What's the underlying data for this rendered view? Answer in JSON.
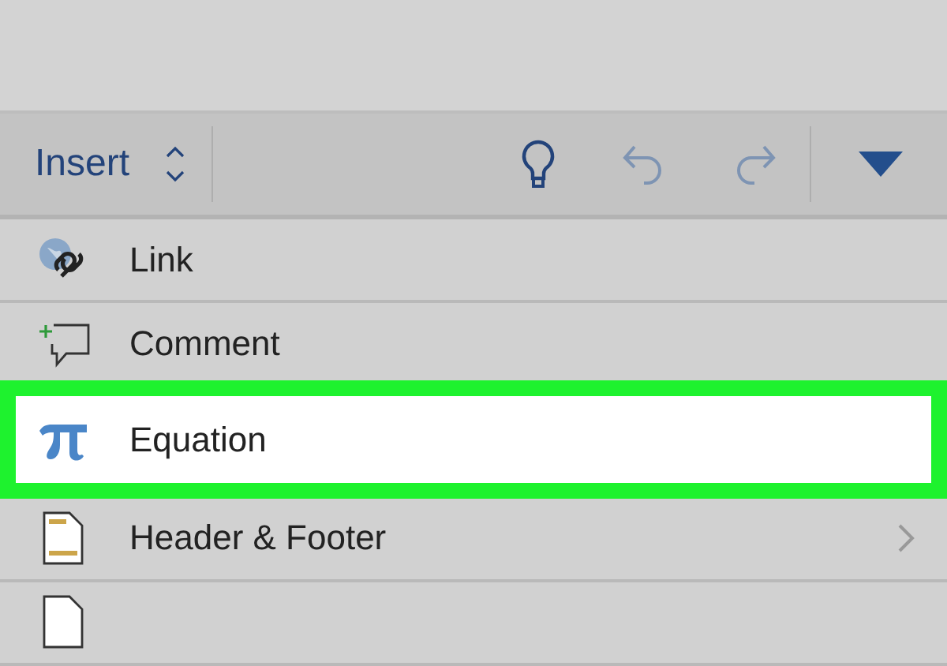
{
  "toolbar": {
    "tab_menu": "Insert"
  },
  "items": [
    {
      "kind": "link",
      "label": "Link",
      "selected": false,
      "submenu": false
    },
    {
      "kind": "comment",
      "label": "Comment",
      "selected": false,
      "submenu": false
    },
    {
      "kind": "equation",
      "label": "Equation",
      "selected": true,
      "submenu": false
    },
    {
      "kind": "header",
      "label": "Header & Footer",
      "selected": false,
      "submenu": true
    },
    {
      "kind": "page",
      "selected": false,
      "submenu": false
    }
  ]
}
